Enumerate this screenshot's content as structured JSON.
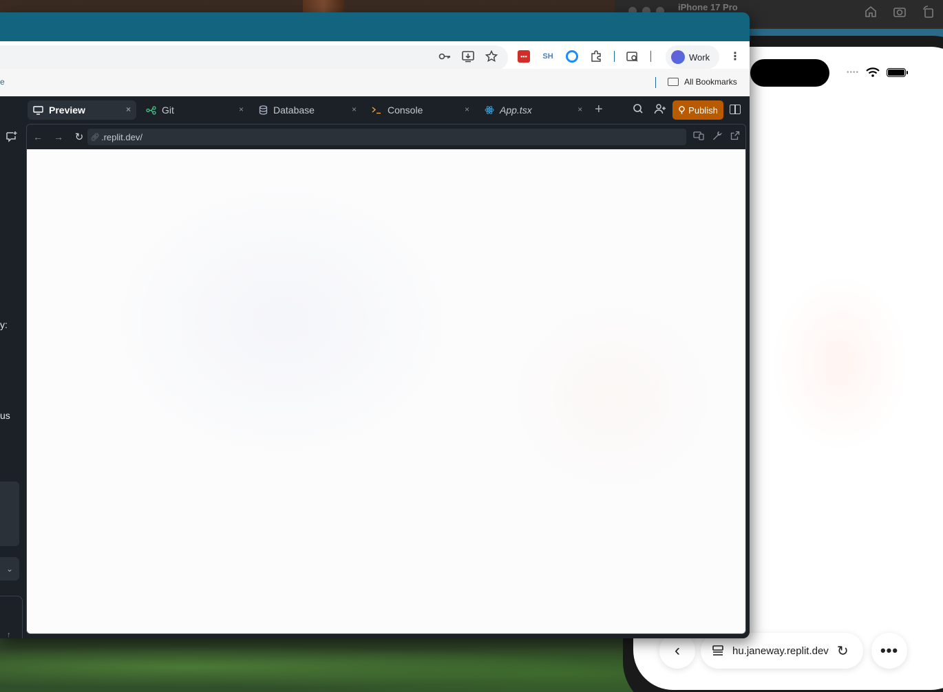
{
  "simulator": {
    "title": "iPhone 17 Pro",
    "toolbar_icons": [
      "home-icon",
      "screenshot-icon",
      "rotate-icon"
    ]
  },
  "phone": {
    "status_icons": [
      "cellular-dots-icon",
      "wifi-icon",
      "battery-icon"
    ],
    "cell_dots": "••••",
    "safari": {
      "url": "hu.janeway.replit.dev",
      "back_glyph": "‹",
      "reload_glyph": "↻",
      "more_glyph": "•••"
    }
  },
  "chrome": {
    "omnibox_icons": [
      "password-key-icon",
      "install-app-icon",
      "bookmark-star-icon"
    ],
    "extensions": {
      "lastpass_label": "•••",
      "sh_label": "SH"
    },
    "profile_name": "Work",
    "bookmarks_left_fragment": "e",
    "all_bookmarks_label": "All Bookmarks"
  },
  "replit": {
    "tabs": [
      {
        "label": "Preview",
        "icon": "monitor-icon",
        "active": true
      },
      {
        "label": "Git",
        "icon": "git-branch-icon",
        "active": false
      },
      {
        "label": "Database",
        "icon": "database-icon",
        "active": false
      },
      {
        "label": "Console",
        "icon": "terminal-icon",
        "active": false
      },
      {
        "label": "App.tsx",
        "icon": "react-icon",
        "active": false
      }
    ],
    "close_glyph": "×",
    "add_tab_glyph": "+",
    "publish_label": "Publish",
    "left_fragments": [
      "y:",
      "us"
    ],
    "preview": {
      "url": ".replit.dev/"
    }
  },
  "colors": {
    "titlebar": "#13657f",
    "publish": "#b85a00",
    "workspace_bg": "#1c2128"
  }
}
